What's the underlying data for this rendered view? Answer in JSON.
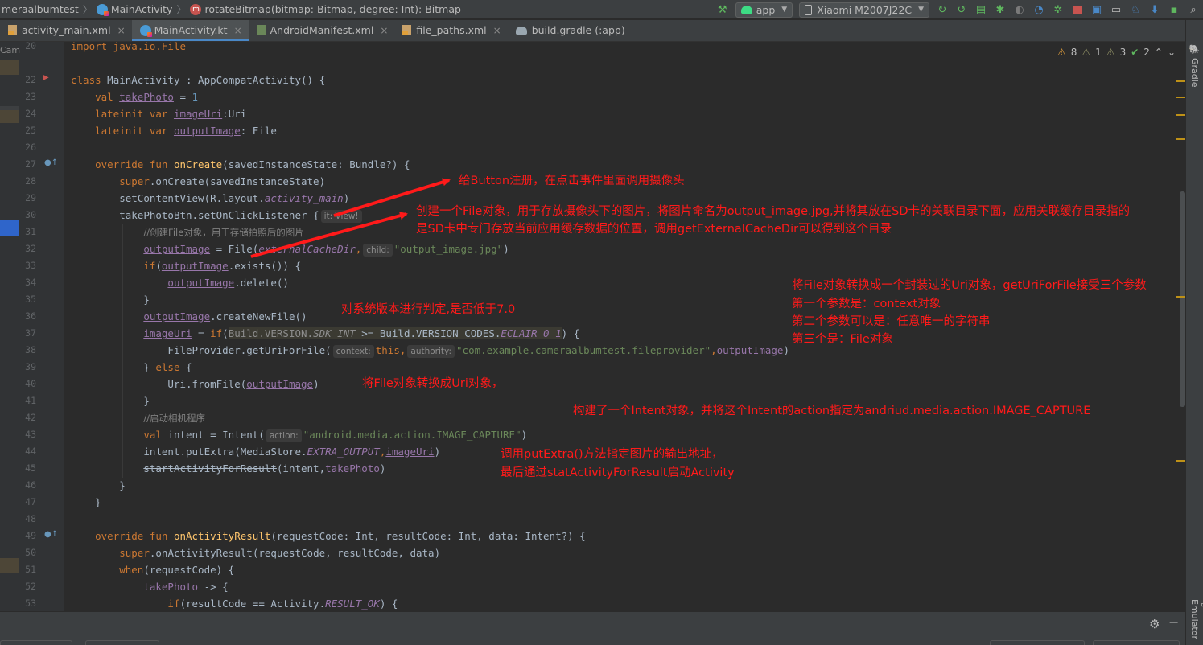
{
  "breadcrumb": {
    "project": "meraalbumtest",
    "class": "MainActivity",
    "method": "rotateBitmap(bitmap: Bitmap, degree: Int): Bitmap"
  },
  "toolbar": {
    "run_config": "app",
    "device": "Xiaomi M2007J22C"
  },
  "tabs": [
    {
      "label": "activity_main.xml",
      "icon": "xml-file-icon"
    },
    {
      "label": "MainActivity.kt",
      "icon": "kotlin-file-icon",
      "active": true
    },
    {
      "label": "AndroidManifest.xml",
      "icon": "manifest-file-icon"
    },
    {
      "label": "file_paths.xml",
      "icon": "xml-file-icon"
    },
    {
      "label": "build.gradle (:app)",
      "icon": "gradle-icon"
    }
  ],
  "left_strip_label": "Cam",
  "inspections": {
    "warnings": "8",
    "weak_warnings": "1",
    "typos": "3",
    "ok": "2"
  },
  "right_bar": {
    "gradle": "Gradle",
    "emulator": "Emulator"
  },
  "line_numbers": [
    "20",
    "22",
    "23",
    "24",
    "25",
    "26",
    "27",
    "28",
    "29",
    "30",
    "31",
    "32",
    "33",
    "34",
    "35",
    "36",
    "37",
    "38",
    "39",
    "40",
    "41",
    "42",
    "43",
    "44",
    "45",
    "46",
    "47",
    "48",
    "49",
    "50",
    "51",
    "52",
    "53"
  ],
  "code": {
    "l20": "import java.io.File",
    "l22_kw": "class",
    "l22_name": "MainActivity",
    "l22_rest": " : AppCompatActivity() {",
    "l23_kw": "val",
    "l23_name": "takePhoto",
    "l23_eq": " = ",
    "l23_num": "1",
    "l24_kw": "lateinit var",
    "l24_name": "imageUri",
    "l24_type": ":Uri",
    "l25_kw": "lateinit var",
    "l25_name": "outputImage",
    "l25_type": ": File",
    "l27_kw": "override fun",
    "l27_fn": "onCreate",
    "l27_rest": "(savedInstanceState: Bundle?) {",
    "l28_kw": "super",
    "l28_rest": ".onCreate(savedInstanceState)",
    "l29_a": "setContentView(R.layout.",
    "l29_prop": "activity_main",
    "l29_b": ")",
    "l30_a": "takePhotoBtn.setOnClickListener {",
    "l30_hint": "it: View!",
    "l31": "//创建File对象，用于存储拍照后的图片",
    "l32_name": "outputImage",
    "l32_a": " = File(",
    "l32_prop": "externalCacheDir",
    "l32_comma": ",",
    "l32_hint": "child:",
    "l32_str": "\"output_image.jpg\"",
    "l32_b": ")",
    "l33_kw": "if",
    "l33_a": "(",
    "l33_name": "outputImage",
    "l33_b": ".exists()) {",
    "l34_name": "outputImage",
    "l34_b": ".delete()",
    "l35": "}",
    "l36_name": "outputImage",
    "l36_b": ".createNewFile()",
    "l37_name": "imageUri",
    "l37_a": " = ",
    "l37_kw": "if",
    "l37_b": "(",
    "l37_c": "Build.VERSION.",
    "l37_prop1": "SDK_INT",
    "l37_d": " >= Build.VERSION_CODES.",
    "l37_prop2": "ECLAIR_0_1",
    "l37_e": ") {",
    "l38_a": "FileProvider.getUriForFile(",
    "l38_hint1": "context:",
    "l38_kw": "this",
    "l38_comma": ",",
    "l38_hint2": "authority:",
    "l38_str1": "\"com.example.",
    "l38_str2": "cameraalbumtest",
    "l38_str3": ".",
    "l38_str4": "fileprovider",
    "l38_str5": "\"",
    "l38_comma2": ",",
    "l38_name": "outputImage",
    "l38_b": ")",
    "l39_a": "} ",
    "l39_kw": "else",
    "l39_b": " {",
    "l40_a": "Uri.fromFile(",
    "l40_name": "outputImage",
    "l40_b": ")",
    "l41": "}",
    "l42": "//启动相机程序",
    "l43_kw": "val",
    "l43_a": " intent = Intent(",
    "l43_hint": "action:",
    "l43_str": "\"android.media.action.IMAGE_CAPTURE\"",
    "l43_b": ")",
    "l44_a": "intent.putExtra(MediaStore.",
    "l44_prop": "EXTRA_OUTPUT",
    "l44_comma": ",",
    "l44_name": "imageUri",
    "l44_b": ")",
    "l45_strike": "startActivityForResult",
    "l45_a": "(intent,",
    "l45_prop": "takePhoto",
    "l45_b": ")",
    "l46": "}",
    "l47": "}",
    "l49_kw": "override fun",
    "l49_fn": "onActivityResult",
    "l49_rest": "(requestCode: Int, resultCode: Int, data: Intent?) {",
    "l50_kw": "super",
    "l50_a": ".",
    "l50_strike": "onActivityResult",
    "l50_b": "(requestCode, resultCode, data)",
    "l51_kw": "when",
    "l51_b": "(requestCode) {",
    "l52_prop": "takePhoto",
    "l52_b": " -> {",
    "l53_kw": "if",
    "l53_a": "(resultCode == Activity.",
    "l53_prop": "RESULT_OK",
    "l53_b": ") {"
  },
  "annotations": {
    "button": "给Button注册，在点击事件里面调用摄像头",
    "file1": "创建一个File对象，用于存放摄像头下的图片，将图片命名为output_image.jpg,并将其放在SD卡的关联目录下面，应用关联缓存目录指的",
    "file2": "是SD卡中专门存放当前应用缓存数据的位置，调用getExternalCacheDir可以得到这个目录",
    "version": "对系统版本进行判定,是否低于7.0",
    "uri1": "将File对象转换成一个封装过的Uri对象，getUriForFile接受三个参数",
    "uri2": "第一个参数是：context对象",
    "uri3": "第二个参数可以是：任意唯一的字符串",
    "uri4": "第三个是：File对象",
    "fromfile": "将File对象转换成Uri对象，",
    "intent": "构建了一个Intent对象，并将这个Intent的action指定为andriud.media.action.IMAGE_CAPTURE",
    "put1": "调用putExtra()方法指定图片的输出地址，",
    "put2": "最后通过statActivityForResult启动Activity"
  },
  "colors": {
    "annotation": "#ff1a1a",
    "keyword": "#cc7832",
    "string": "#6a8759",
    "property": "#9876aa",
    "function": "#ffc66d"
  }
}
